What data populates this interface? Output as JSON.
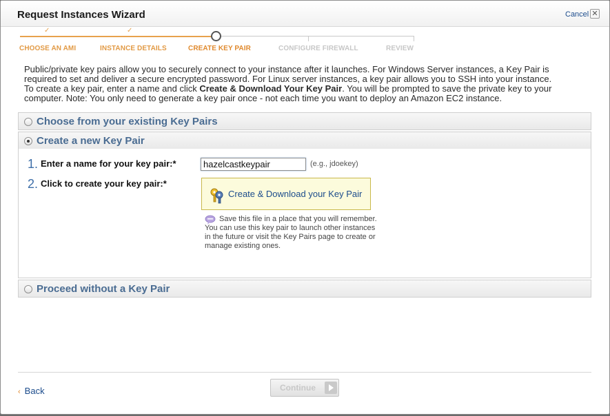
{
  "window": {
    "title": "Request Instances Wizard",
    "cancel_label": "Cancel",
    "close_glyph": "✕"
  },
  "steps": [
    {
      "label": "CHOOSE AN AMI",
      "state": "done"
    },
    {
      "label": "INSTANCE DETAILS",
      "state": "done"
    },
    {
      "label": "CREATE KEY PAIR",
      "state": "current"
    },
    {
      "label": "CONFIGURE FIREWALL",
      "state": "todo"
    },
    {
      "label": "REVIEW",
      "state": "todo"
    }
  ],
  "description": {
    "line1": "Public/private key pairs allow you to securely connect to your instance after it launches. For Windows Server instances, a Key Pair is",
    "line2": "required to set and deliver a secure encrypted password. For Linux server instances, a key pair allows you to SSH into your instance.",
    "line3_pre": "To create a key pair, enter a name and click ",
    "line3_bold": "Create & Download Your Key Pair",
    "line3_post": ". You will be prompted to save the private key to your",
    "line4": "computer. Note: You only need to generate a key pair once - not each time you want to deploy an Amazon EC2 instance."
  },
  "options": {
    "existing": {
      "label": "Choose from your existing Key Pairs",
      "selected": false
    },
    "create_new": {
      "label": "Create a new Key Pair",
      "selected": true
    },
    "proceed_without": {
      "label": "Proceed without a Key Pair",
      "selected": false
    }
  },
  "create_form": {
    "step1_num": "1.",
    "step1_label": "Enter a name for your key pair:*",
    "name_value": "hazelcastkeypair",
    "name_hint": "(e.g., jdoekey)",
    "step2_num": "2.",
    "step2_label": "Click to create your key pair:*",
    "create_button_label": "Create & Download your Key Pair",
    "info_text": "Save this file in a place that you will remember. You can use this key pair to launch other instances in the future or visit the Key Pairs page to create or manage existing ones."
  },
  "footer": {
    "back_chevron": "‹",
    "back_label": "Back",
    "continue_label": "Continue"
  },
  "colors": {
    "accent_orange": "#e29a45",
    "link_blue": "#1c4c8c",
    "header_blue": "#4a6c92",
    "button_yellow": "#fcfbdc"
  }
}
